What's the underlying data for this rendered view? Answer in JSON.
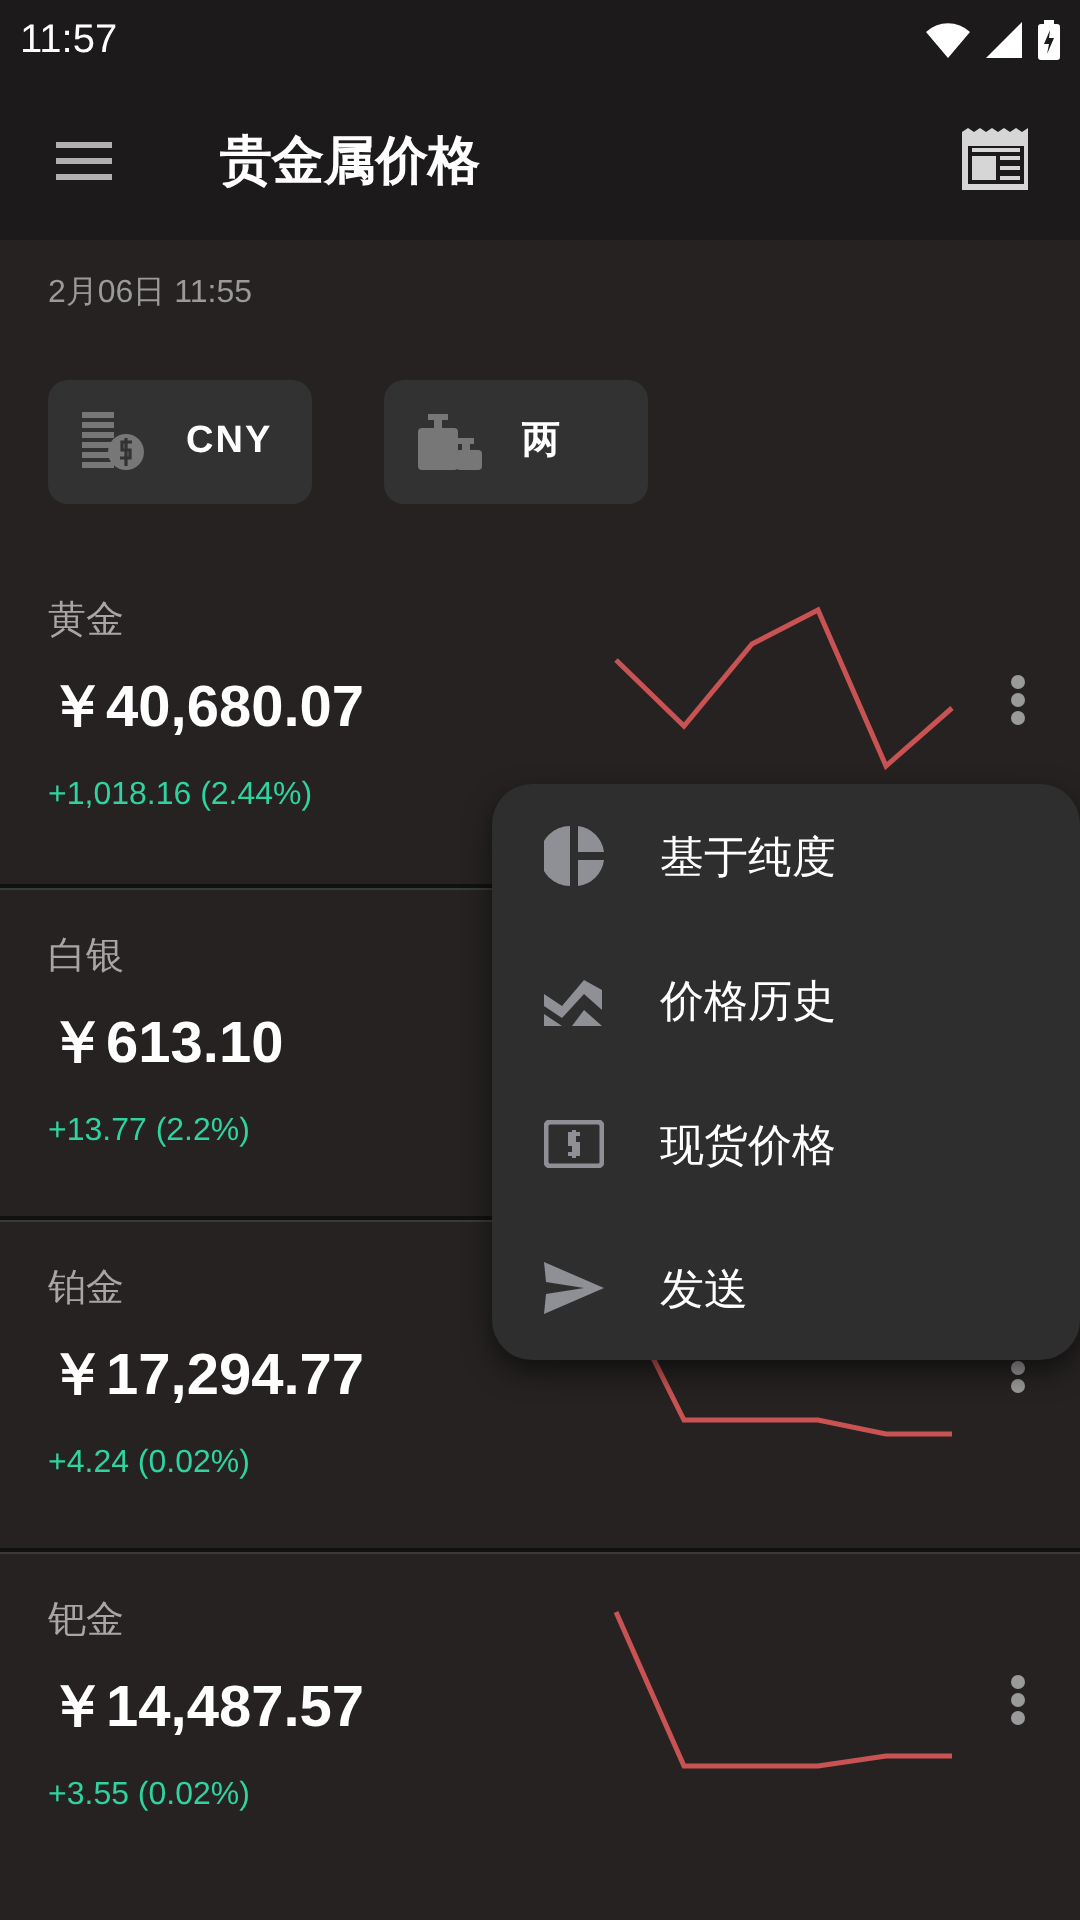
{
  "status_bar": {
    "time": "11:57"
  },
  "app_bar": {
    "title": "贵金属价格"
  },
  "updated": "2月06日 11:55",
  "chips": [
    {
      "kind": "currency",
      "label": "CNY"
    },
    {
      "kind": "weight",
      "label": "两"
    }
  ],
  "metals": [
    {
      "name": "黄金",
      "price": "￥40,680.07",
      "change": "+1,018.16 (2.44%)"
    },
    {
      "name": "白银",
      "price": "￥613.10",
      "change": "+13.77 (2.2%)"
    },
    {
      "name": "铂金",
      "price": "￥17,294.77",
      "change": "+4.24 (0.02%)"
    },
    {
      "name": "钯金",
      "price": "￥14,487.57",
      "change": "+3.55 (0.02%)"
    }
  ],
  "menu": [
    {
      "kind": "purity",
      "label": "基于纯度"
    },
    {
      "kind": "history",
      "label": "价格历史"
    },
    {
      "kind": "spot",
      "label": "现货价格"
    },
    {
      "kind": "send",
      "label": "发送"
    }
  ]
}
